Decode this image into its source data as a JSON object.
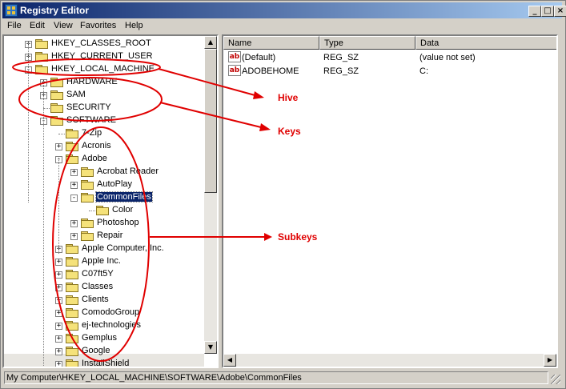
{
  "window": {
    "title": "Registry Editor"
  },
  "menu": [
    {
      "label": "File"
    },
    {
      "label": "Edit"
    },
    {
      "label": "View"
    },
    {
      "label": "Favorites"
    },
    {
      "label": "Help"
    }
  ],
  "tree": [
    {
      "label": "HKEY_CLASSES_ROOT",
      "level": 0,
      "expander": "+"
    },
    {
      "label": "HKEY_CURRENT_USER",
      "level": 0,
      "expander": "+"
    },
    {
      "label": "HKEY_LOCAL_MACHINE",
      "level": 0,
      "expander": "-"
    },
    {
      "label": "HARDWARE",
      "level": 1,
      "expander": "+"
    },
    {
      "label": "SAM",
      "level": 1,
      "expander": "+"
    },
    {
      "label": "SECURITY",
      "level": 1,
      "expander": ""
    },
    {
      "label": "SOFTWARE",
      "level": 1,
      "expander": "-"
    },
    {
      "label": "7-Zip",
      "level": 2,
      "expander": ""
    },
    {
      "label": "Acronis",
      "level": 2,
      "expander": "+"
    },
    {
      "label": "Adobe",
      "level": 2,
      "expander": "-"
    },
    {
      "label": "Acrobat Reader",
      "level": 3,
      "expander": "+"
    },
    {
      "label": "AutoPlay",
      "level": 3,
      "expander": "+"
    },
    {
      "label": "CommonFiles",
      "level": 3,
      "expander": "-",
      "selected": true
    },
    {
      "label": "Color",
      "level": 4,
      "expander": ""
    },
    {
      "label": "Photoshop",
      "level": 3,
      "expander": "+"
    },
    {
      "label": "Repair",
      "level": 3,
      "expander": "+"
    },
    {
      "label": "Apple Computer, Inc.",
      "level": 2,
      "expander": "+"
    },
    {
      "label": "Apple Inc.",
      "level": 2,
      "expander": "+"
    },
    {
      "label": "C07ft5Y",
      "level": 2,
      "expander": "+"
    },
    {
      "label": "Classes",
      "level": 2,
      "expander": "+"
    },
    {
      "label": "Clients",
      "level": 2,
      "expander": "+"
    },
    {
      "label": "ComodoGroup",
      "level": 2,
      "expander": "+"
    },
    {
      "label": "ej-technologies",
      "level": 2,
      "expander": "+"
    },
    {
      "label": "Gemplus",
      "level": 2,
      "expander": "+"
    },
    {
      "label": "Google",
      "level": 2,
      "expander": "+"
    },
    {
      "label": "InstallShield",
      "level": 2,
      "expander": "+"
    }
  ],
  "list": {
    "headers": {
      "name": "Name",
      "type": "Type",
      "data": "Data"
    },
    "rows": [
      {
        "name": "(Default)",
        "type": "REG_SZ",
        "data": "(value not set)",
        "icon": "ab"
      },
      {
        "name": "ADOBEHOME",
        "type": "REG_SZ",
        "data": "C:",
        "icon": "ab"
      }
    ]
  },
  "status": {
    "path": "My Computer\\HKEY_LOCAL_MACHINE\\SOFTWARE\\Adobe\\CommonFiles"
  },
  "annotations": {
    "hive": "Hive",
    "keys": "Keys",
    "subkeys": "Subkeys",
    "color": "#e00000"
  },
  "icons": {
    "app": "registry-editor-icon",
    "folder": "folder-icon",
    "value": "string-value-icon"
  }
}
